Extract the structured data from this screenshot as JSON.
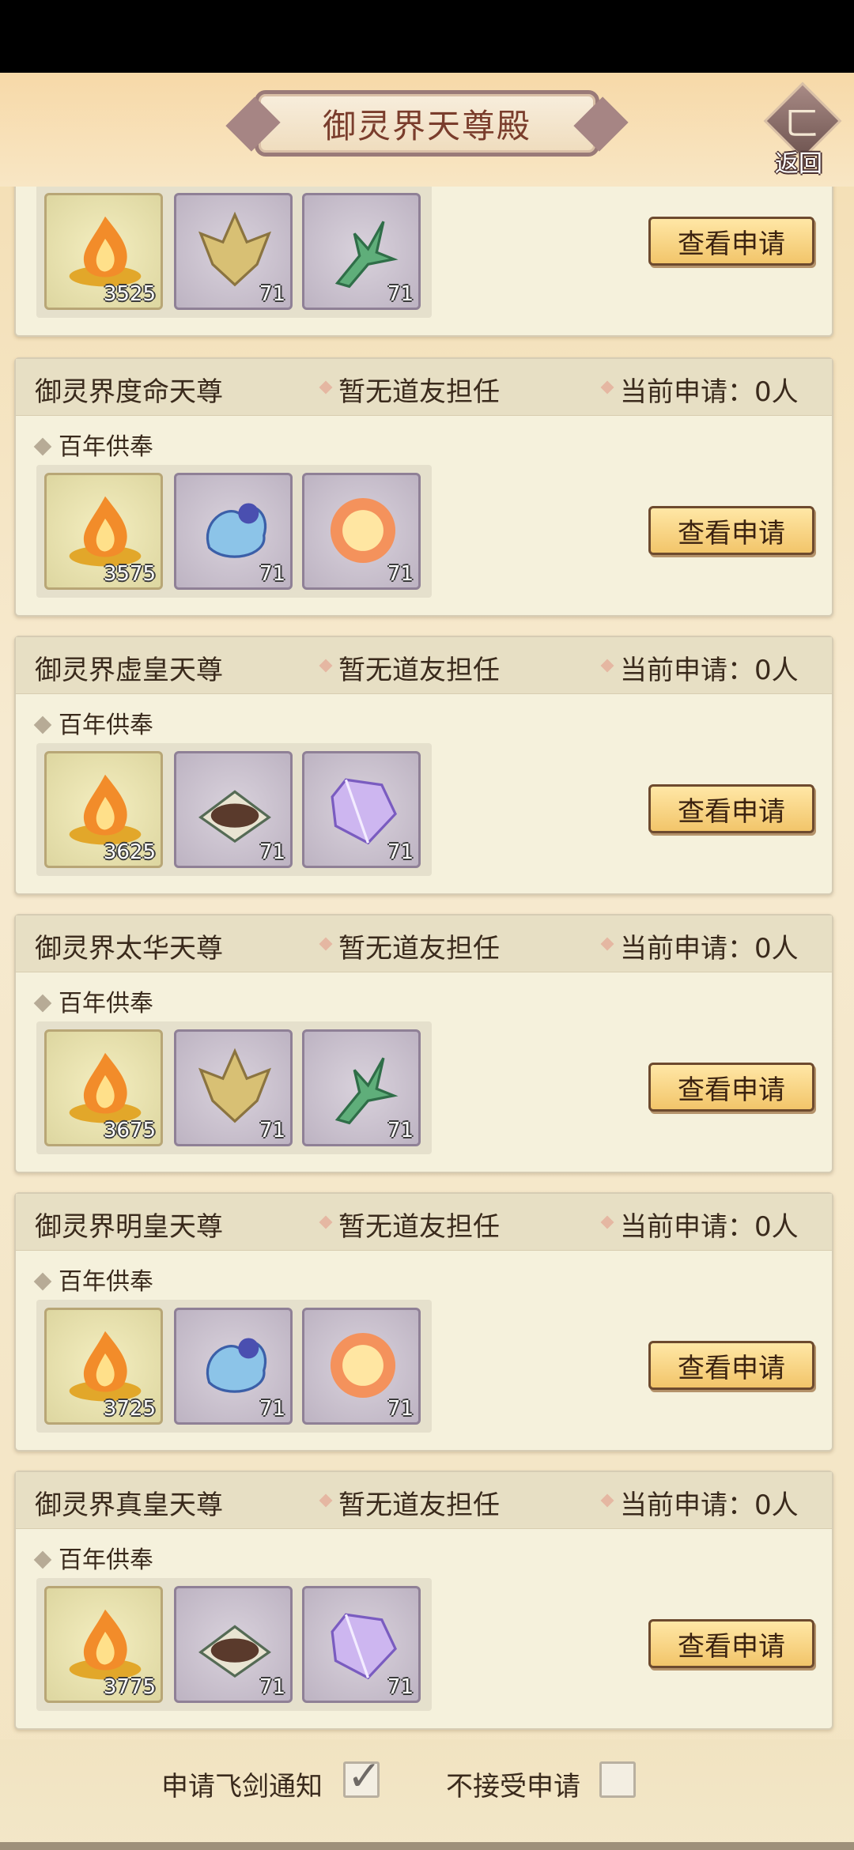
{
  "header": {
    "title": "御灵界天尊殿",
    "back_label": "返回"
  },
  "cards": [
    {
      "rank": "",
      "status": "",
      "apply": "",
      "offering": "",
      "items": [
        {
          "kind": "flame",
          "qty": "3525"
        },
        {
          "kind": "gold-crystal",
          "qty": "71"
        },
        {
          "kind": "jade-branch",
          "qty": "71"
        }
      ],
      "button": "查看申请"
    },
    {
      "rank": "御灵界度命天尊",
      "status": "暂无道友担任",
      "apply": "当前申请：0人",
      "offering": "百年供奉",
      "items": [
        {
          "kind": "flame",
          "qty": "3575"
        },
        {
          "kind": "water-spirit",
          "qty": "71"
        },
        {
          "kind": "fire-orb",
          "qty": "71"
        }
      ],
      "button": "查看申请"
    },
    {
      "rank": "御灵界虚皇天尊",
      "status": "暂无道友担任",
      "apply": "当前申请：0人",
      "offering": "百年供奉",
      "items": [
        {
          "kind": "flame",
          "qty": "3625"
        },
        {
          "kind": "ore-tray",
          "qty": "71"
        },
        {
          "kind": "purple-crystal",
          "qty": "71"
        }
      ],
      "button": "查看申请"
    },
    {
      "rank": "御灵界太华天尊",
      "status": "暂无道友担任",
      "apply": "当前申请：0人",
      "offering": "百年供奉",
      "items": [
        {
          "kind": "flame",
          "qty": "3675"
        },
        {
          "kind": "gold-crystal",
          "qty": "71"
        },
        {
          "kind": "jade-branch",
          "qty": "71"
        }
      ],
      "button": "查看申请"
    },
    {
      "rank": "御灵界明皇天尊",
      "status": "暂无道友担任",
      "apply": "当前申请：0人",
      "offering": "百年供奉",
      "items": [
        {
          "kind": "flame",
          "qty": "3725"
        },
        {
          "kind": "water-spirit",
          "qty": "71"
        },
        {
          "kind": "fire-orb",
          "qty": "71"
        }
      ],
      "button": "查看申请"
    },
    {
      "rank": "御灵界真皇天尊",
      "status": "暂无道友担任",
      "apply": "当前申请：0人",
      "offering": "百年供奉",
      "items": [
        {
          "kind": "flame",
          "qty": "3775"
        },
        {
          "kind": "ore-tray",
          "qty": "71"
        },
        {
          "kind": "purple-crystal",
          "qty": "71"
        }
      ],
      "button": "查看申请"
    }
  ],
  "footer": {
    "notify_label": "申请飞剑通知",
    "notify_checked": true,
    "reject_label": "不接受申请",
    "reject_checked": false
  }
}
